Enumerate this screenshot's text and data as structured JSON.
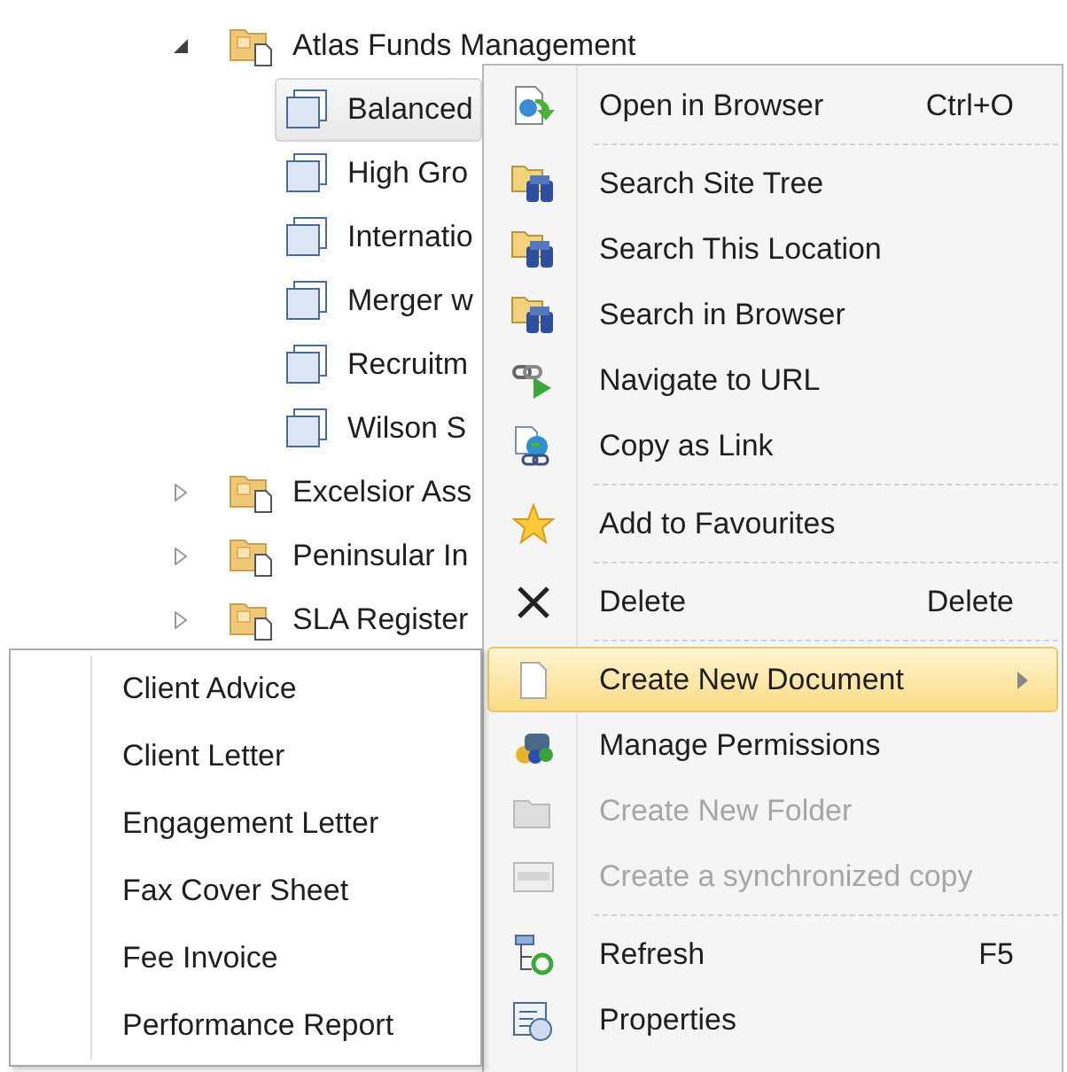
{
  "tree": {
    "items": [
      {
        "label": "Atlas Funds Management",
        "expanded": true,
        "children": [
          {
            "label": "Balanced",
            "selected": true
          },
          {
            "label": "High Gro",
            "selected": false
          },
          {
            "label": "Internatio",
            "selected": false
          },
          {
            "label": "Merger w",
            "selected": false
          },
          {
            "label": "Recruitm",
            "selected": false
          },
          {
            "label": "Wilson S",
            "selected": false
          }
        ]
      },
      {
        "label": "Excelsior Ass",
        "expanded": false
      },
      {
        "label": "Peninsular In",
        "expanded": false
      },
      {
        "label": "SLA Register",
        "expanded": false
      }
    ]
  },
  "context_menu": {
    "items": [
      {
        "kind": "item",
        "label": "Open in Browser",
        "shortcut": "Ctrl+O",
        "disabled": false,
        "selected": false,
        "submenu": false
      },
      {
        "kind": "separator"
      },
      {
        "kind": "item",
        "label": "Search Site Tree",
        "disabled": false,
        "selected": false,
        "submenu": false
      },
      {
        "kind": "item",
        "label": "Search This Location",
        "disabled": false,
        "selected": false,
        "submenu": false
      },
      {
        "kind": "item",
        "label": "Search in Browser",
        "disabled": false,
        "selected": false,
        "submenu": false
      },
      {
        "kind": "item",
        "label": "Navigate to URL",
        "disabled": false,
        "selected": false,
        "submenu": false
      },
      {
        "kind": "item",
        "label": "Copy as Link",
        "disabled": false,
        "selected": false,
        "submenu": false
      },
      {
        "kind": "separator"
      },
      {
        "kind": "item",
        "label": "Add to Favourites",
        "disabled": false,
        "selected": false,
        "submenu": false
      },
      {
        "kind": "separator"
      },
      {
        "kind": "item",
        "label": "Delete",
        "shortcut": "Delete",
        "disabled": false,
        "selected": false,
        "submenu": false
      },
      {
        "kind": "separator"
      },
      {
        "kind": "item",
        "label": "Create New Document",
        "disabled": false,
        "selected": true,
        "submenu": true
      },
      {
        "kind": "item",
        "label": "Manage Permissions",
        "disabled": false,
        "selected": false,
        "submenu": false
      },
      {
        "kind": "item",
        "label": "Create New Folder",
        "disabled": true,
        "selected": false,
        "submenu": false
      },
      {
        "kind": "item",
        "label": "Create a synchronized copy",
        "disabled": true,
        "selected": false,
        "submenu": false
      },
      {
        "kind": "separator"
      },
      {
        "kind": "item",
        "label": "Refresh",
        "shortcut": "F5",
        "disabled": false,
        "selected": false,
        "submenu": false
      },
      {
        "kind": "item",
        "label": "Properties",
        "disabled": false,
        "selected": false,
        "submenu": false
      }
    ]
  },
  "submenu": {
    "items": [
      "Client Advice",
      "Client Letter",
      "Engagement Letter",
      "Fax Cover Sheet",
      "Fee Invoice",
      "Performance Report"
    ]
  }
}
